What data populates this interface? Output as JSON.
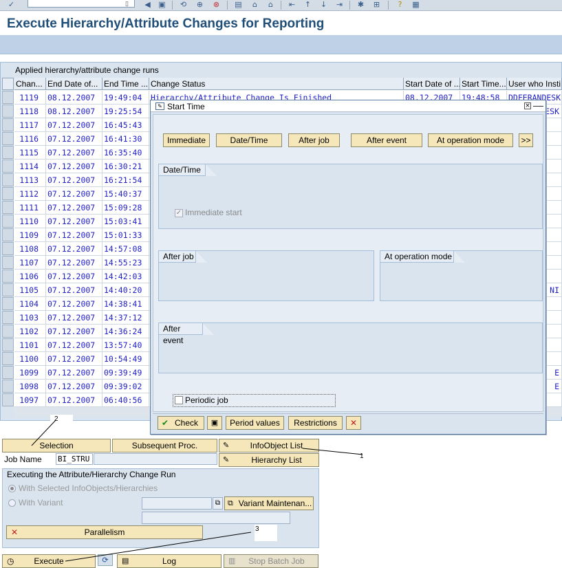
{
  "toolbar": {
    "command_field": "",
    "icons": [
      "enter-icon",
      "back-icon",
      "exit-icon",
      "cancel-icon",
      "save-icon",
      "print-icon",
      "find-icon",
      "find-next-icon",
      "first-page-icon",
      "prev-page-icon",
      "next-page-icon",
      "last-page-icon",
      "new-session-icon",
      "shortcut-icon",
      "help-icon",
      "layout-icon"
    ]
  },
  "page_title": "Execute Hierarchy/Attribute Changes for Reporting",
  "table": {
    "caption": "Applied hierarchy/attribute change runs",
    "columns": [
      "Chan...",
      "End Date of...",
      "End Time ...",
      "Change Status",
      "Start Date of ...",
      "Start Time...",
      "User who Insti"
    ],
    "rows": [
      {
        "id": "1119",
        "end_date": "08.12.2007",
        "end_time": "19:49:04",
        "status": "Hierarchy/Attribute Change Is Finished",
        "start_date": "08.12.2007",
        "start_time": "19:48:58",
        "user": "DDFERANDESK"
      },
      {
        "id": "1118",
        "end_date": "08.12.2007",
        "end_time": "19:25:54",
        "user_tail": "ESK"
      },
      {
        "id": "1117",
        "end_date": "07.12.2007",
        "end_time": "16:45:43"
      },
      {
        "id": "1116",
        "end_date": "07.12.2007",
        "end_time": "16:41:30"
      },
      {
        "id": "1115",
        "end_date": "07.12.2007",
        "end_time": "16:35:40"
      },
      {
        "id": "1114",
        "end_date": "07.12.2007",
        "end_time": "16:30:21"
      },
      {
        "id": "1113",
        "end_date": "07.12.2007",
        "end_time": "16:21:54"
      },
      {
        "id": "1112",
        "end_date": "07.12.2007",
        "end_time": "15:40:37"
      },
      {
        "id": "1111",
        "end_date": "07.12.2007",
        "end_time": "15:09:28"
      },
      {
        "id": "1110",
        "end_date": "07.12.2007",
        "end_time": "15:03:41"
      },
      {
        "id": "1109",
        "end_date": "07.12.2007",
        "end_time": "15:01:33"
      },
      {
        "id": "1108",
        "end_date": "07.12.2007",
        "end_time": "14:57:08"
      },
      {
        "id": "1107",
        "end_date": "07.12.2007",
        "end_time": "14:55:23"
      },
      {
        "id": "1106",
        "end_date": "07.12.2007",
        "end_time": "14:42:03"
      },
      {
        "id": "1105",
        "end_date": "07.12.2007",
        "end_time": "14:40:20",
        "user_tail": "NI"
      },
      {
        "id": "1104",
        "end_date": "07.12.2007",
        "end_time": "14:38:41"
      },
      {
        "id": "1103",
        "end_date": "07.12.2007",
        "end_time": "14:37:12"
      },
      {
        "id": "1102",
        "end_date": "07.12.2007",
        "end_time": "14:36:24"
      },
      {
        "id": "1101",
        "end_date": "07.12.2007",
        "end_time": "13:57:40"
      },
      {
        "id": "1100",
        "end_date": "07.12.2007",
        "end_time": "10:54:49"
      },
      {
        "id": "1099",
        "end_date": "07.12.2007",
        "end_time": "09:39:49",
        "user_tail": "E"
      },
      {
        "id": "1098",
        "end_date": "07.12.2007",
        "end_time": "09:39:02",
        "user_tail": "E"
      },
      {
        "id": "1097",
        "end_date": "07.12.2007",
        "end_time": "06:40:56"
      }
    ]
  },
  "buttons": {
    "selection": "Selection",
    "subsequent_proc": "Subsequent Proc.",
    "infoobject_list": "InfoObject List",
    "hierarchy_list": "Hierarchy List",
    "variant_maint": "Variant Maintenan...",
    "parallelism": "Parallelism",
    "execute": "Execute",
    "log": "Log",
    "stop_batch_job": "Stop Batch Job"
  },
  "job": {
    "label": "Job Name",
    "value": "BI_STRU"
  },
  "exec_group": {
    "title": "Executing the Attribute/Hierarchy Change Run",
    "option_selected": "With Selected InfoObjects/Hierarchies",
    "option_variant": "With Variant"
  },
  "annotations": [
    "1",
    "2",
    "3"
  ],
  "dialog": {
    "title": "Start Time",
    "buttons": [
      "Immediate",
      "Date/Time",
      "After job",
      "After event",
      "At operation mode",
      ">>"
    ],
    "group_datetime": "Date/Time",
    "immediate_start": "Immediate start",
    "group_after_job": "After job",
    "group_at_op_mode": "At operation mode",
    "group_after_event": "After event",
    "periodic_job": "Periodic job",
    "footer": {
      "check": "Check",
      "period_values": "Period values",
      "restrictions": "Restrictions"
    }
  },
  "colors": {
    "title": "#1f4e79",
    "table_text": "#2020c8",
    "button_bg": "#f5e7b9",
    "group_bg": "#d9e4ef"
  }
}
